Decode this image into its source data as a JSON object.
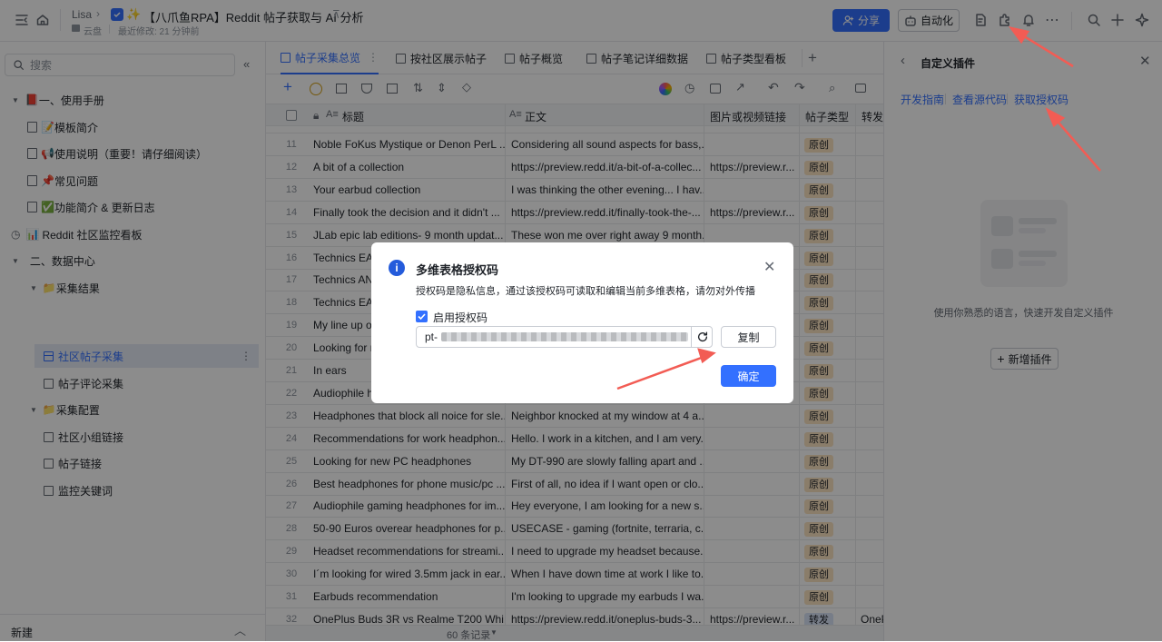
{
  "topbar": {
    "breadcrumb_user": "Lisa",
    "doc_title": "【八爪鱼RPA】Reddit 帖子获取与 AI 分析",
    "location": "云盘",
    "last_modified": "最近修改: 21 分钟前",
    "share_label": "分享",
    "automation_label": "自动化"
  },
  "sidebar": {
    "search_placeholder": "搜索",
    "items": [
      {
        "label": "一、使用手册"
      },
      {
        "label": "模板简介"
      },
      {
        "label": "使用说明（重要！请仔细阅读）"
      },
      {
        "label": "常见问题"
      },
      {
        "label": "功能简介 & 更新日志"
      },
      {
        "label": "Reddit 社区监控看板"
      },
      {
        "label": "二、数据中心"
      },
      {
        "label": "采集结果"
      },
      {
        "label": "社区帖子采集"
      },
      {
        "label": "帖子评论采集"
      },
      {
        "label": "采集配置"
      },
      {
        "label": "社区小组链接"
      },
      {
        "label": "帖子链接"
      },
      {
        "label": "监控关键词"
      }
    ],
    "new_label": "新建"
  },
  "tabs": [
    {
      "label": "帖子采集总览"
    },
    {
      "label": "按社区展示帖子"
    },
    {
      "label": "帖子概览"
    },
    {
      "label": "帖子笔记详细数据"
    },
    {
      "label": "帖子类型看板"
    }
  ],
  "table": {
    "columns": [
      "标题",
      "正文",
      "图片或视频链接",
      "帖子类型",
      "转发"
    ],
    "rows": [
      {
        "n": "11",
        "title": "Noble FoKus Mystique or Denon PerL ...",
        "body": "Considering all sound aspects for bass,...",
        "media": "",
        "type": "原创"
      },
      {
        "n": "12",
        "title": "A bit of a collection",
        "body": "https://preview.redd.it/a-bit-of-a-collec...",
        "media": "https://preview.r...",
        "type": "原创"
      },
      {
        "n": "13",
        "title": "Your earbud collection",
        "body": "I was thinking the other evening... I hav...",
        "media": "",
        "type": "原创"
      },
      {
        "n": "14",
        "title": "Finally took the decision and it didn't ...",
        "body": "https://preview.redd.it/finally-took-the-...",
        "media": "https://preview.r...",
        "type": "原创"
      },
      {
        "n": "15",
        "title": "JLab epic lab editions- 9 month updat...",
        "body": "These won me over right away 9 month...",
        "media": "",
        "type": "原创"
      },
      {
        "n": "16",
        "title": "Technics EAH...",
        "body": "",
        "media": "",
        "type": "原创"
      },
      {
        "n": "17",
        "title": "Technics AN...",
        "body": "",
        "media": "",
        "type": "原创"
      },
      {
        "n": "18",
        "title": "Technics EAH...",
        "body": "",
        "media": "",
        "type": "原创"
      },
      {
        "n": "19",
        "title": "My line up of...",
        "body": "",
        "media": "",
        "type": "原创"
      },
      {
        "n": "20",
        "title": "Looking for n...",
        "body": "",
        "media": "",
        "type": "原创"
      },
      {
        "n": "21",
        "title": "In ears",
        "body": "",
        "media": "",
        "type": "原创"
      },
      {
        "n": "22",
        "title": "Audiophile h...",
        "body": "",
        "media": "",
        "type": "原创"
      },
      {
        "n": "23",
        "title": "Headphones that block all noice for sle...",
        "body": "Neighbor knocked at my window at 4 a...",
        "media": "",
        "type": "原创"
      },
      {
        "n": "24",
        "title": "Recommendations for work headphon...",
        "body": "Hello. I work in a kitchen, and I am very...",
        "media": "",
        "type": "原创"
      },
      {
        "n": "25",
        "title": "Looking for new PC headphones",
        "body": "My DT-990 are slowly falling apart and ...",
        "media": "",
        "type": "原创"
      },
      {
        "n": "26",
        "title": "Best headphones for phone music/pc ...",
        "body": "First of all, no idea if I want open or clo...",
        "media": "",
        "type": "原创"
      },
      {
        "n": "27",
        "title": "Audiophile gaming headphones for im...",
        "body": "Hey everyone, I am looking for a new s...",
        "media": "",
        "type": "原创"
      },
      {
        "n": "28",
        "title": "50-90 Euros overear headphones for p...",
        "body": "USECASE - gaming (fortnite, terraria, c...",
        "media": "",
        "type": "原创"
      },
      {
        "n": "29",
        "title": "Headset recommendations for streami...",
        "body": "I need to upgrade my headset because...",
        "media": "",
        "type": "原创"
      },
      {
        "n": "30",
        "title": "I´m looking for wired 3.5mm jack in ear...",
        "body": "When I have down time at work I like to...",
        "media": "",
        "type": "原创"
      },
      {
        "n": "31",
        "title": "Earbuds recommendation",
        "body": "I'm looking to upgrade my earbuds I wa...",
        "media": "",
        "type": "原创"
      },
      {
        "n": "32",
        "title": "OnePlus Buds 3R vs Realme T200 Whi...",
        "body": "https://preview.redd.it/oneplus-buds-3...",
        "media": "https://preview.r...",
        "type": "转发",
        "fwd": "OneP"
      }
    ],
    "record_count": "60 条记录"
  },
  "colors": {
    "accent": "#3370ff",
    "original_tag": "#fbe3c1",
    "forward_tag": "#d9e3f7"
  },
  "right_panel": {
    "title": "自定义插件",
    "links": [
      "开发指南",
      "查看源代码",
      "获取授权码"
    ],
    "empty_text": "使用你熟悉的语言，快速开发自定义插件",
    "add_label": "新增插件"
  },
  "dialog": {
    "title": "多维表格授权码",
    "desc": "授权码是隐私信息，通过该授权码可读取和编辑当前多维表格，请勿对外传播",
    "checkbox_label": "启用授权码",
    "code_prefix": "pt-",
    "copy_label": "复制",
    "confirm_label": "确定"
  }
}
